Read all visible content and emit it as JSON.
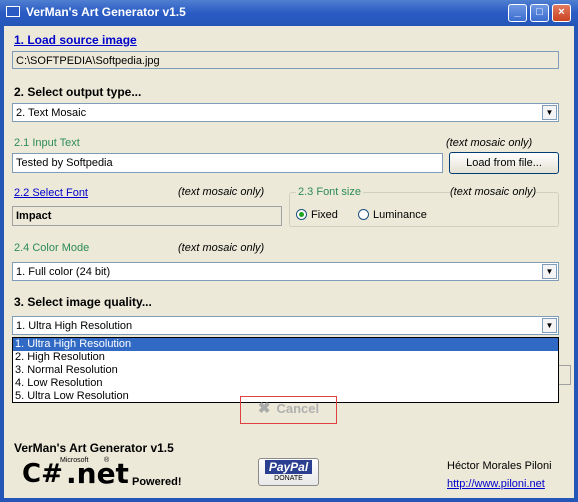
{
  "window": {
    "title": "VerMan's Art Generator v1.5",
    "buttons": [
      "_",
      "□",
      "×"
    ]
  },
  "source": {
    "link": "1. Load source image",
    "path": "C:\\SOFTPEDIA\\Softpedia.jpg"
  },
  "output": {
    "heading": "2. Select output type...",
    "selected": "2. Text Mosaic"
  },
  "input_text": {
    "label": "2.1 Input Text",
    "note": "(text mosaic only)",
    "value": "Tested by Softpedia",
    "load_button": "Load from file..."
  },
  "font": {
    "label": "2.2 Select Font",
    "note": "(text mosaic only)",
    "value": "Impact"
  },
  "font_size": {
    "label": "2.3 Font size",
    "note": "(text mosaic only)",
    "fixed": "Fixed",
    "luminance": "Luminance",
    "selected": "Fixed"
  },
  "color_mode": {
    "label": "2.4 Color Mode",
    "note": "(text mosaic only)",
    "selected": "1. Full color (24 bit)"
  },
  "quality": {
    "heading": "3. Select image quality...",
    "selected": "1. Ultra High Resolution",
    "options": [
      "1. Ultra High Resolution",
      "2. High Resolution",
      "3. Normal Resolution",
      "4. Low Resolution",
      "5. Ultra Low Resolution"
    ]
  },
  "cancel_button": "Cancel",
  "footer": {
    "app_name": "VerMan's Art Generator v1.5",
    "csharp": "C#",
    "microsoft": "Microsoft",
    "registered": "®",
    "net": ".net",
    "powered": "Powered!",
    "paypal": "PayPal",
    "donate": "DONATE",
    "author": "Héctor Morales Piloni",
    "url": "http://www.piloni.net"
  }
}
